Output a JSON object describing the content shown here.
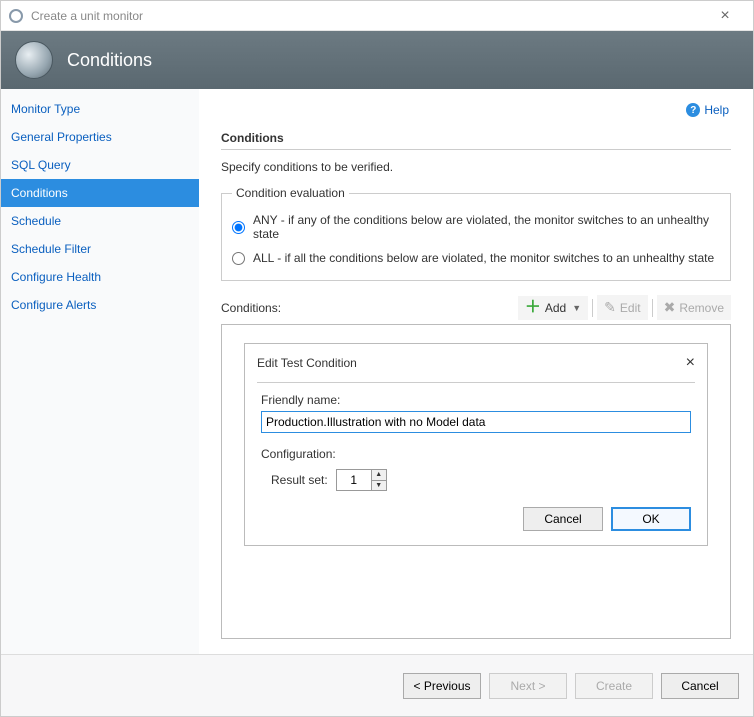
{
  "window": {
    "title": "Create a unit monitor"
  },
  "banner": {
    "title": "Conditions"
  },
  "help": {
    "label": "Help"
  },
  "sidebar": {
    "items": [
      {
        "label": "Monitor Type"
      },
      {
        "label": "General Properties"
      },
      {
        "label": "SQL Query"
      },
      {
        "label": "Conditions",
        "active": true
      },
      {
        "label": "Schedule"
      },
      {
        "label": "Schedule Filter"
      },
      {
        "label": "Configure Health"
      },
      {
        "label": "Configure Alerts"
      }
    ]
  },
  "content": {
    "section_title": "Conditions",
    "description": "Specify conditions to be verified.",
    "fieldset_legend": "Condition evaluation",
    "radio_any": "ANY - if any of the conditions below are violated, the monitor switches to an unhealthy state",
    "radio_all": "ALL - if all the conditions below are violated, the monitor switches to an unhealthy state",
    "radio_selected": "any",
    "conditions_label": "Conditions:",
    "toolbar": {
      "add": "Add",
      "edit": "Edit",
      "remove": "Remove"
    }
  },
  "dialog": {
    "title": "Edit Test Condition",
    "friendly_name_label": "Friendly name:",
    "friendly_name_value": "Production.Illustration with no Model data",
    "configuration_label": "Configuration:",
    "result_set_label": "Result set:",
    "result_set_value": "1",
    "cancel": "Cancel",
    "ok": "OK"
  },
  "footer": {
    "previous": "< Previous",
    "next": "Next >",
    "create": "Create",
    "cancel": "Cancel"
  }
}
